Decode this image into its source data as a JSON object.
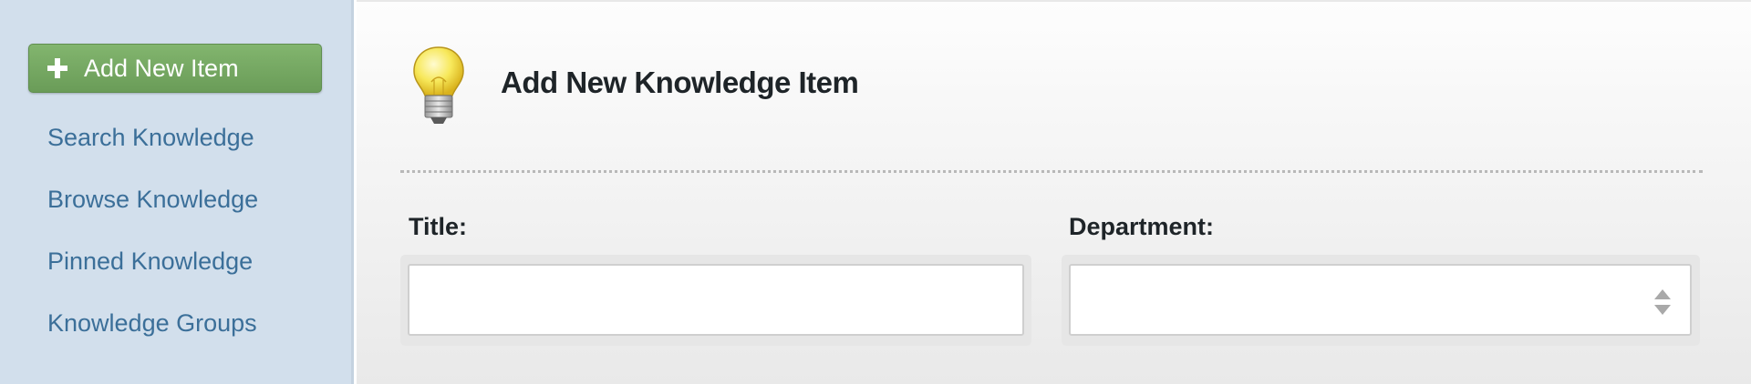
{
  "sidebar": {
    "add_button_label": "Add New Item",
    "items": [
      {
        "label": "Search Knowledge"
      },
      {
        "label": "Browse Knowledge"
      },
      {
        "label": "Pinned Knowledge"
      },
      {
        "label": "Knowledge Groups"
      }
    ]
  },
  "main": {
    "title": "Add New Knowledge Item",
    "title_icon": "lightbulb-icon",
    "fields": {
      "title": {
        "label": "Title:",
        "value": ""
      },
      "department": {
        "label": "Department:",
        "value": ""
      }
    }
  },
  "colors": {
    "sidebar_bg": "#d2dfec",
    "accent_green": "#6a9c58",
    "link_blue": "#3b6f99",
    "title_text": "#1e2428"
  }
}
